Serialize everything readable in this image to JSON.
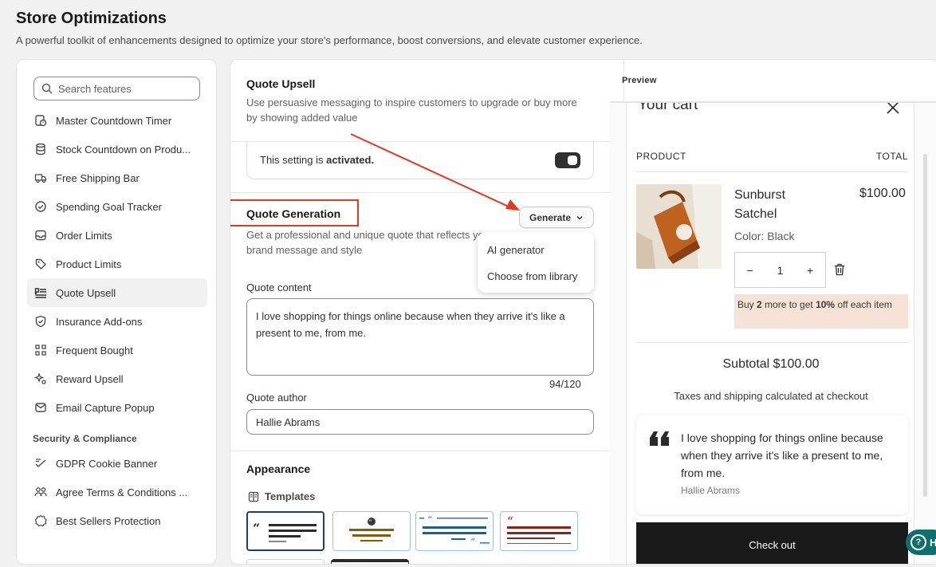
{
  "page": {
    "title": "Store Optimizations",
    "subtitle": "A powerful toolkit of enhancements designed to optimize your store's performance, boost conversions, and elevate customer experience."
  },
  "sidebar": {
    "search_placeholder": "Search features",
    "items": [
      {
        "label": "Master Countdown Timer",
        "icon": "timer-icon"
      },
      {
        "label": "Stock Countdown on Produ...",
        "icon": "database-icon"
      },
      {
        "label": "Free Shipping Bar",
        "icon": "truck-icon"
      },
      {
        "label": "Spending Goal Tracker",
        "icon": "check-circle-icon"
      },
      {
        "label": "Order Limits",
        "icon": "inbox-icon"
      },
      {
        "label": "Product Limits",
        "icon": "tag-icon"
      },
      {
        "label": "Quote Upsell",
        "icon": "quote-icon",
        "active": true
      },
      {
        "label": "Insurance Add-ons",
        "icon": "shield-check-icon"
      },
      {
        "label": "Frequent Bought",
        "icon": "grid-icon"
      },
      {
        "label": "Reward Upsell",
        "icon": "sparkle-icon"
      },
      {
        "label": "Email Capture Popup",
        "icon": "email-icon"
      }
    ],
    "section_title": "Security & Compliance",
    "security_items": [
      {
        "label": "GDPR Cookie Banner",
        "icon": "cookie-icon"
      },
      {
        "label": "Agree Terms & Conditions ...",
        "icon": "people-icon"
      },
      {
        "label": "Best Sellers Protection",
        "icon": "badge-icon"
      }
    ]
  },
  "settings": {
    "title": "Quote Upsell",
    "description": "Use persuasive messaging to inspire customers to upgrade or buy more by showing added value",
    "activated_prefix": "This setting is ",
    "activated_bold": "activated.",
    "quote_generation_title": "Quote Generation",
    "quote_generation_desc": "Get a professional and unique quote that reflects your brand message and style",
    "generate_button": "Generate",
    "dropdown_options": [
      "AI generator",
      "Choose from library"
    ],
    "quote_content_label": "Quote content",
    "quote_content_value": "I love shopping for things online because when they arrive it's like a present to me, from me.",
    "char_counter": "94/120",
    "quote_author_label": "Quote author",
    "quote_author_value": "Hallie Abrams",
    "appearance_title": "Appearance",
    "templates_label": "Templates"
  },
  "preview": {
    "label": "Preview",
    "cart_title": "Your cart",
    "col_product": "PRODUCT",
    "col_total": "TOTAL",
    "product_name": "Sunburst Satchel",
    "product_price": "$100.00",
    "product_color": "Color: Black",
    "quantity": "1",
    "promo_pre": "Buy ",
    "promo_num": "2",
    "promo_mid": " more to get ",
    "promo_pct": "10%",
    "promo_post": " off each item",
    "subtotal": "Subtotal $100.00",
    "taxes": "Taxes and shipping calculated at checkout",
    "quote_text": "I love shopping for things online because when they arrive it's like a present to me, from me.",
    "quote_author": "Hallie Abrams",
    "checkout": "Check out"
  },
  "help_button": "H",
  "colors": {
    "highlight_red": "#e03a22",
    "toggle_on": "#303030",
    "promo_bg": "#f6e2d6",
    "checkout_bg": "#1a1a1a",
    "help_bg": "#0f6f6b"
  }
}
